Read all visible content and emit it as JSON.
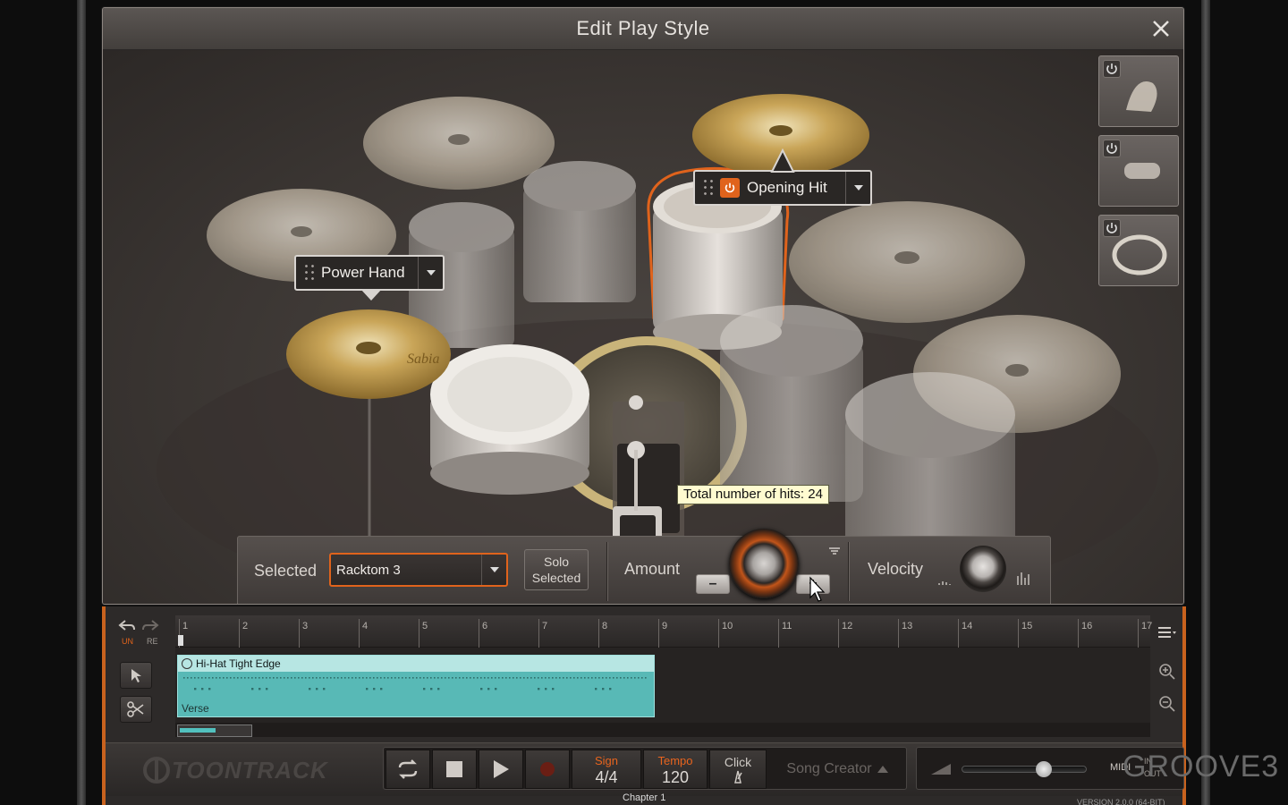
{
  "dialog": {
    "title": "Edit Play Style",
    "close_icon": "close-icon"
  },
  "tags": {
    "power_hand": "Power Hand",
    "opening_hit": "Opening Hit"
  },
  "tooltip": "Total number of hits: 24",
  "controls": {
    "selected_label": "Selected",
    "selected_value": "Racktom 3",
    "solo_line1": "Solo",
    "solo_line2": "Selected",
    "amount_label": "Amount",
    "minus": "–",
    "plus": "+",
    "velocity_label": "Velocity"
  },
  "timeline": {
    "undo": "UN",
    "redo": "RE",
    "bars": [
      "1",
      "2",
      "3",
      "4",
      "5",
      "6",
      "7",
      "8",
      "9",
      "10",
      "11",
      "12",
      "13",
      "14",
      "15",
      "16",
      "17"
    ],
    "clip_title": "Hi-Hat Tight Edge",
    "clip_section": "Verse"
  },
  "transport": {
    "logo": "TOONTRACK",
    "sign_label": "Sign",
    "sign_value": "4/4",
    "tempo_label": "Tempo",
    "tempo_value": "120",
    "click_label": "Click",
    "song_creator": "Song Creator",
    "midi_label": "MIDI",
    "in_label": "IN",
    "out_label": "OUT"
  },
  "footer": {
    "chapter": "Chapter 1",
    "version": "VERSION 2.0.0 (64-BIT)",
    "brand": "GROOVE3"
  },
  "colors": {
    "accent": "#e0631c",
    "clip": "#58b9b6"
  }
}
